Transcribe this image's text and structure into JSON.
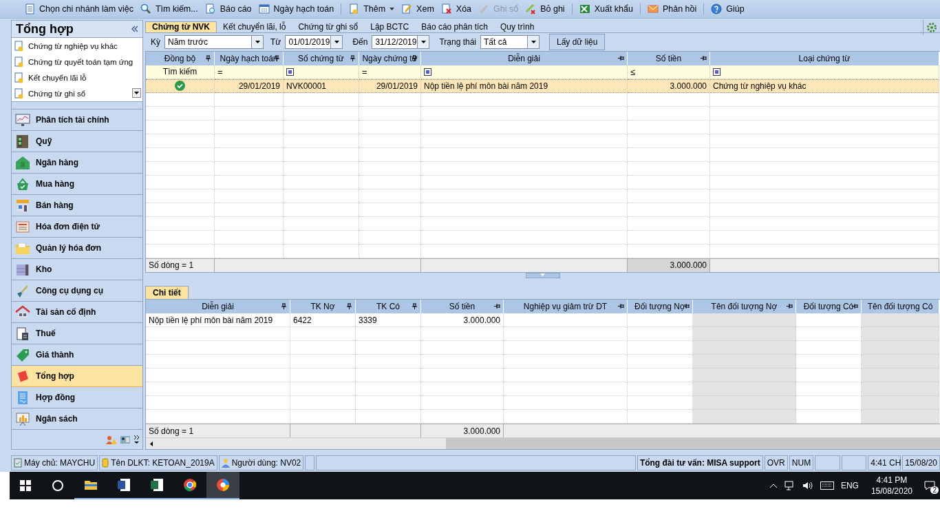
{
  "toolbar": {
    "items": [
      {
        "kind": "button",
        "label": "Chọn chi nhánh làm việc",
        "disabled": false
      },
      {
        "kind": "button",
        "label": "Tìm kiếm...",
        "disabled": false
      },
      {
        "kind": "button",
        "label": "Báo cáo",
        "disabled": false
      },
      {
        "kind": "button",
        "label": "Ngày hạch toán",
        "disabled": false
      },
      {
        "kind": "separator"
      },
      {
        "kind": "dropdown",
        "label": "Thêm",
        "disabled": false
      },
      {
        "kind": "button",
        "label": "Xem",
        "disabled": false
      },
      {
        "kind": "button",
        "label": "Xóa",
        "disabled": false
      },
      {
        "kind": "button",
        "label": "Ghi sổ",
        "disabled": true
      },
      {
        "kind": "button",
        "label": "Bỏ ghi",
        "disabled": false
      },
      {
        "kind": "separator"
      },
      {
        "kind": "button",
        "label": "Xuất khẩu",
        "disabled": false
      },
      {
        "kind": "separator"
      },
      {
        "kind": "button",
        "label": "Phản hồi",
        "disabled": false
      },
      {
        "kind": "separator"
      },
      {
        "kind": "button",
        "label": "Giúp",
        "disabled": false
      }
    ]
  },
  "sidebar": {
    "title": "Tổng hợp",
    "shortcuts": [
      "Chứng từ nghiệp vụ khác",
      "Chứng từ quyết toán tạm ứng",
      "Kết chuyển lãi lỗ",
      "Chứng từ ghi sổ"
    ],
    "modules": [
      {
        "label": "Phân tích tài chính",
        "selected": false
      },
      {
        "label": "Quỹ",
        "selected": false
      },
      {
        "label": "Ngân hàng",
        "selected": false
      },
      {
        "label": "Mua hàng",
        "selected": false
      },
      {
        "label": "Bán hàng",
        "selected": false
      },
      {
        "label": "Hóa đơn điện tử",
        "selected": false
      },
      {
        "label": "Quản lý hóa đơn",
        "selected": false
      },
      {
        "label": "Kho",
        "selected": false
      },
      {
        "label": "Công cụ dụng cụ",
        "selected": false
      },
      {
        "label": "Tài sản cố định",
        "selected": false
      },
      {
        "label": "Thuế",
        "selected": false
      },
      {
        "label": "Giá thành",
        "selected": false
      },
      {
        "label": "Tổng hợp",
        "selected": true
      },
      {
        "label": "Hợp đồng",
        "selected": false
      },
      {
        "label": "Ngân sách",
        "selected": false
      }
    ]
  },
  "tabs": [
    {
      "label": "Chứng từ NVK",
      "selected": true
    },
    {
      "label": "Kết chuyển lãi, lỗ",
      "selected": false
    },
    {
      "label": "Chứng từ ghi sổ",
      "selected": false
    },
    {
      "label": "Lập BCTC",
      "selected": false
    },
    {
      "label": "Báo cáo phân tích",
      "selected": false
    },
    {
      "label": "Quy trình",
      "selected": false
    }
  ],
  "filters": {
    "period_label": "Kỳ",
    "period": "Năm trước",
    "from_label": "Từ",
    "from": "01/01/2019",
    "to_label": "Đến",
    "to": "31/12/2019",
    "status_label": "Trạng thái",
    "status": "Tất cả",
    "fetch_button": "Lấy dữ liệu"
  },
  "table": {
    "columns": [
      {
        "label": "Đồng bộ",
        "pinned": true
      },
      {
        "label": "Ngày hạch toán",
        "pinned": true
      },
      {
        "label": "Số chứng từ",
        "pinned": true
      },
      {
        "label": "Ngày chứng từ",
        "pinned": true
      },
      {
        "label": "Diễn giải",
        "pinned": true
      },
      {
        "label": "Số tiền",
        "pinned": true
      },
      {
        "label": "Loại chứng từ",
        "pinned": false
      }
    ],
    "filter_row": [
      {
        "kind": "text",
        "text": "Tìm kiếm"
      },
      {
        "kind": "operator",
        "text": "="
      },
      {
        "kind": "box"
      },
      {
        "kind": "operator",
        "text": "="
      },
      {
        "kind": "box"
      },
      {
        "kind": "operator",
        "text": "≤"
      },
      {
        "kind": "box"
      }
    ],
    "rows": [
      {
        "selected": true,
        "synced": true,
        "cells": [
          "",
          "29/01/2019",
          "NVK00001",
          "29/01/2019",
          "Nộp tiền lệ phí môn bài năm 2019",
          "3.000.000",
          "Chứng từ nghiệp vụ khác"
        ]
      }
    ],
    "footer": {
      "count": "Số dòng = 1",
      "total": "3.000.000"
    }
  },
  "detail": {
    "tab": "Chi tiết",
    "columns": [
      {
        "label": "Diễn giải",
        "pinned": true,
        "readonly": false
      },
      {
        "label": "TK Nợ",
        "pinned": true,
        "readonly": false
      },
      {
        "label": "TK Có",
        "pinned": true,
        "readonly": false
      },
      {
        "label": "Số tiền",
        "pinned": true,
        "readonly": false
      },
      {
        "label": "Nghiệp vụ giảm trừ DT",
        "pinned": true,
        "readonly": false
      },
      {
        "label": "Đối tượng Nợ",
        "pinned": true,
        "readonly": false
      },
      {
        "label": "Tên đối tượng Nợ",
        "pinned": true,
        "readonly": true
      },
      {
        "label": "Đối tượng Có",
        "pinned": true,
        "readonly": false
      },
      {
        "label": "Tên đối tượng Có",
        "pinned": false,
        "readonly": true
      }
    ],
    "rows": [
      [
        "Nộp tiền lệ phí môn bài năm 2019",
        "6422",
        "3339",
        "3.000.000",
        "",
        "",
        "",
        "",
        ""
      ]
    ],
    "footer": {
      "count": "Số dòng = 1",
      "total": "3.000.000"
    }
  },
  "status_bar": {
    "server": "Máy chủ: MAYCHU",
    "database": "Tên DLKT: KETOAN_2019A",
    "user": "Người dùng: NV02",
    "support": "Tổng đài tư vấn: MISA support",
    "ovr": "OVR",
    "num": "NUM",
    "time": "4:41 CH",
    "date": "15/08/20"
  },
  "taskbar": {
    "language": "ENG",
    "time": "4:41 PM",
    "date": "15/08/2020",
    "notifications": "2"
  }
}
